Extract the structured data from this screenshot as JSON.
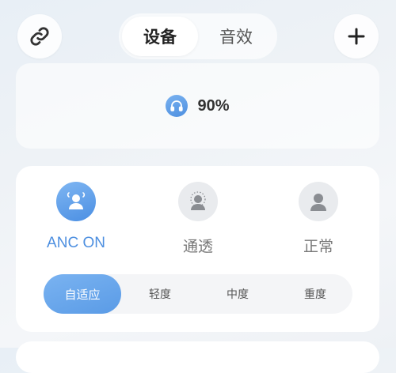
{
  "header": {
    "left_icon": "link-icon",
    "right_icon": "plus-icon",
    "tabs": [
      {
        "label": "设备",
        "active": true
      },
      {
        "label": "音效",
        "active": false
      }
    ]
  },
  "battery": {
    "icon": "headphones-icon",
    "percent": "90%"
  },
  "anc": {
    "modes": [
      {
        "label": "ANC ON",
        "icon": "anc-person-icon",
        "active": true
      },
      {
        "label": "通透",
        "icon": "transparency-person-icon",
        "active": false
      },
      {
        "label": "正常",
        "icon": "normal-person-icon",
        "active": false
      }
    ],
    "levels": [
      {
        "label": "自适应",
        "active": true
      },
      {
        "label": "轻度",
        "active": false
      },
      {
        "label": "中度",
        "active": false
      },
      {
        "label": "重度",
        "active": false
      }
    ]
  },
  "colors": {
    "accent": "#4d8fe0",
    "inactive_icon_bg": "#e9ebee"
  }
}
